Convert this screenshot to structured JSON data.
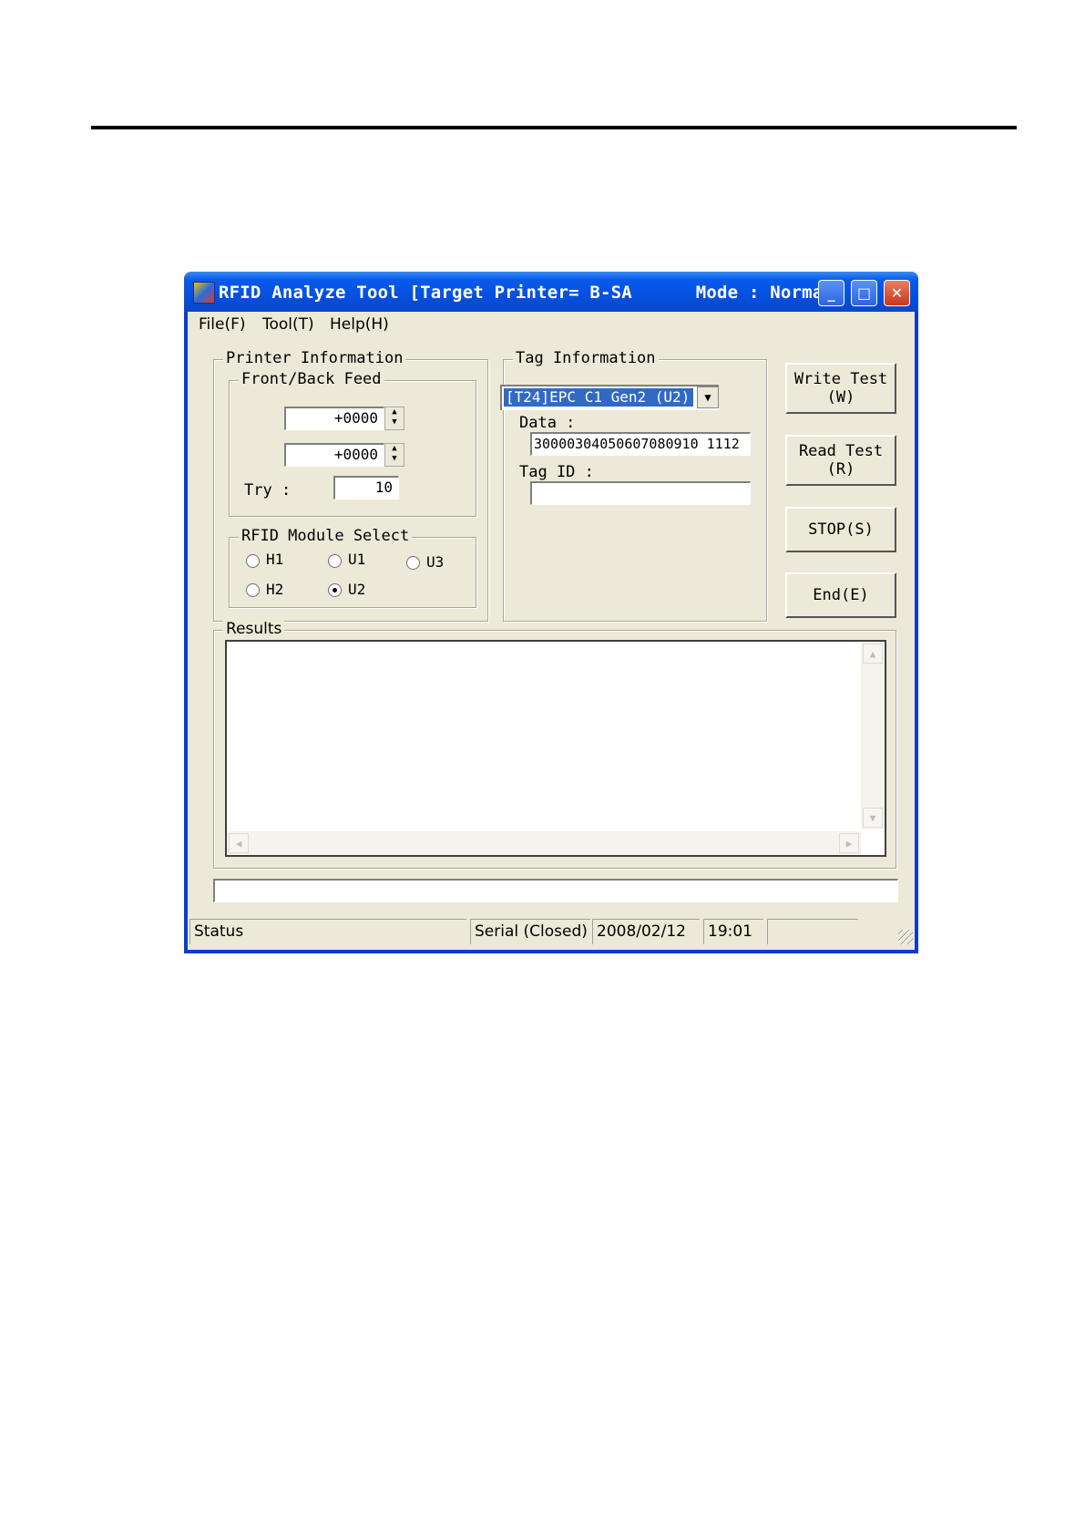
{
  "window": {
    "title": "RFID Analyze Tool [Target Printer= B-SA      Mode : Normal]",
    "minimize_glyph": "_",
    "maximize_glyph": "□",
    "close_glyph": "✕"
  },
  "menu": {
    "items": [
      {
        "label": "File(F)"
      },
      {
        "label": "Tool(T)"
      },
      {
        "label": "Help(H)"
      }
    ]
  },
  "printer_information": {
    "title": "Printer Information",
    "front_back_feed": {
      "title": "Front/Back Feed",
      "front_value": "+0000",
      "back_value": "+0000"
    },
    "try_label": "Try :",
    "try_value": "10",
    "rfid_module": {
      "title": "RFID Module Select",
      "options": [
        {
          "label": "H1",
          "selected": false
        },
        {
          "label": "U1",
          "selected": false
        },
        {
          "label": "U3",
          "selected": false
        },
        {
          "label": "H2",
          "selected": false
        },
        {
          "label": "U2",
          "selected": true
        }
      ]
    }
  },
  "tag_information": {
    "title": "Tag Information",
    "tag_type_selected": "[T24]EPC C1 Gen2 (U2)",
    "data_label": "Data :",
    "data_value": "30000304050607080910 1112",
    "tag_id_label": "Tag ID :",
    "tag_id_value": ""
  },
  "buttons": {
    "write_test": [
      "Write Test",
      "(W)"
    ],
    "read_test": [
      "Read Test",
      "(R)"
    ],
    "stop": "STOP(S)",
    "end": "End(E)"
  },
  "results": {
    "title": "Results",
    "content": ""
  },
  "statusbar": {
    "status": "Status",
    "connection": "Serial (Closed)",
    "date": "2008/02/12",
    "time": "19:01",
    "extra": ""
  },
  "colors": {
    "titlebar": "#0550e0",
    "client_bg": "#ece9d8",
    "selection": "#316ac5",
    "close_button": "#c8381f"
  }
}
